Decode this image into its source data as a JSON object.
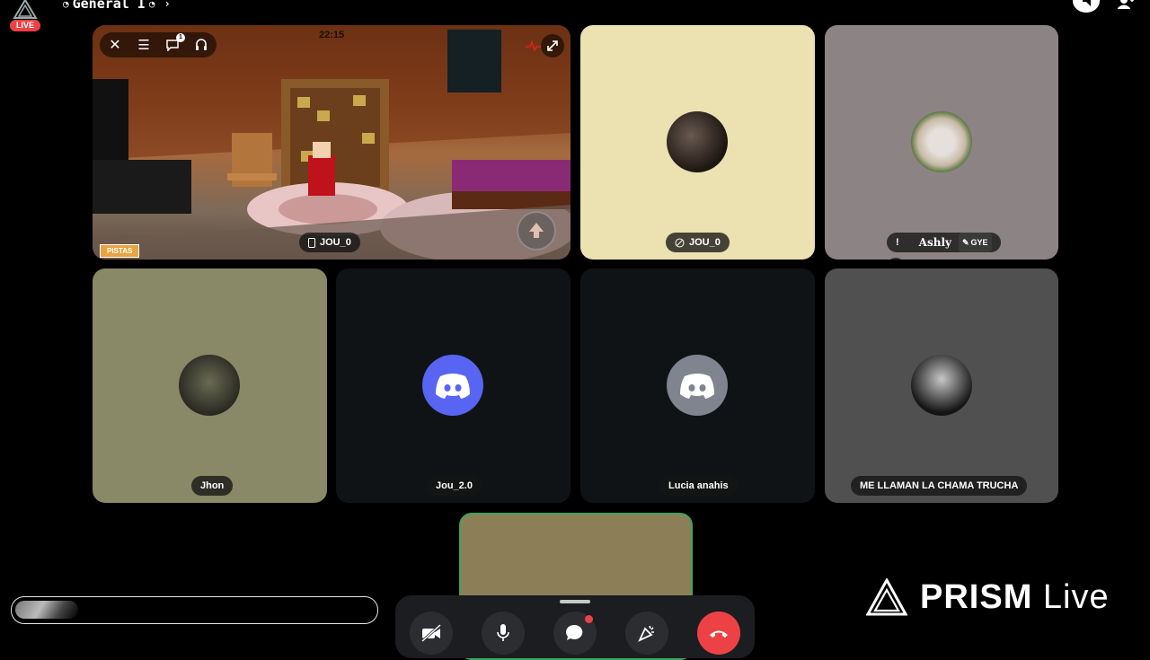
{
  "header": {
    "channel_title": "General I",
    "live_badge": "LIVE"
  },
  "stream": {
    "timer": "22:15",
    "pistas_label": "PISTAS",
    "user_label": "JOU_0",
    "icons": [
      "close-icon",
      "menu-icon",
      "chat-icon",
      "headset-icon",
      "expand-icon",
      "heartbeat-icon",
      "jump-icon"
    ],
    "chat_count": "1"
  },
  "tiles": {
    "jou0_cam": {
      "name": "JOU_0",
      "bg": "#ebe1b1"
    },
    "ashly": {
      "prefix": "!",
      "name": "Ashly",
      "tag": "GYE",
      "bg": "#8c8384"
    },
    "jhon": {
      "name": "Jhon",
      "bg": "#898867"
    },
    "jou20": {
      "name": "Jou_2.0",
      "bg": "#101316",
      "avatar_bg": "#5865f2"
    },
    "lucia": {
      "name": "Lucia anahis",
      "bg": "#101316",
      "avatar_bg": "#80848e"
    },
    "chama": {
      "name": "ME LLAMAN LA CHAMA TRUCHA",
      "bg": "#4f504f"
    }
  },
  "self_view": {
    "bg": "#8c7f58",
    "border": "#3ba55d"
  },
  "controls": [
    "camera-off-icon",
    "microphone-icon",
    "chat-icon",
    "activity-icon",
    "hang-up-icon"
  ],
  "brand": {
    "bold": "PRISM",
    "light": "Live"
  },
  "colors": {
    "live_red": "#ed4245",
    "discord_blurple": "#5865f2",
    "hangup_red": "#ed4245"
  }
}
